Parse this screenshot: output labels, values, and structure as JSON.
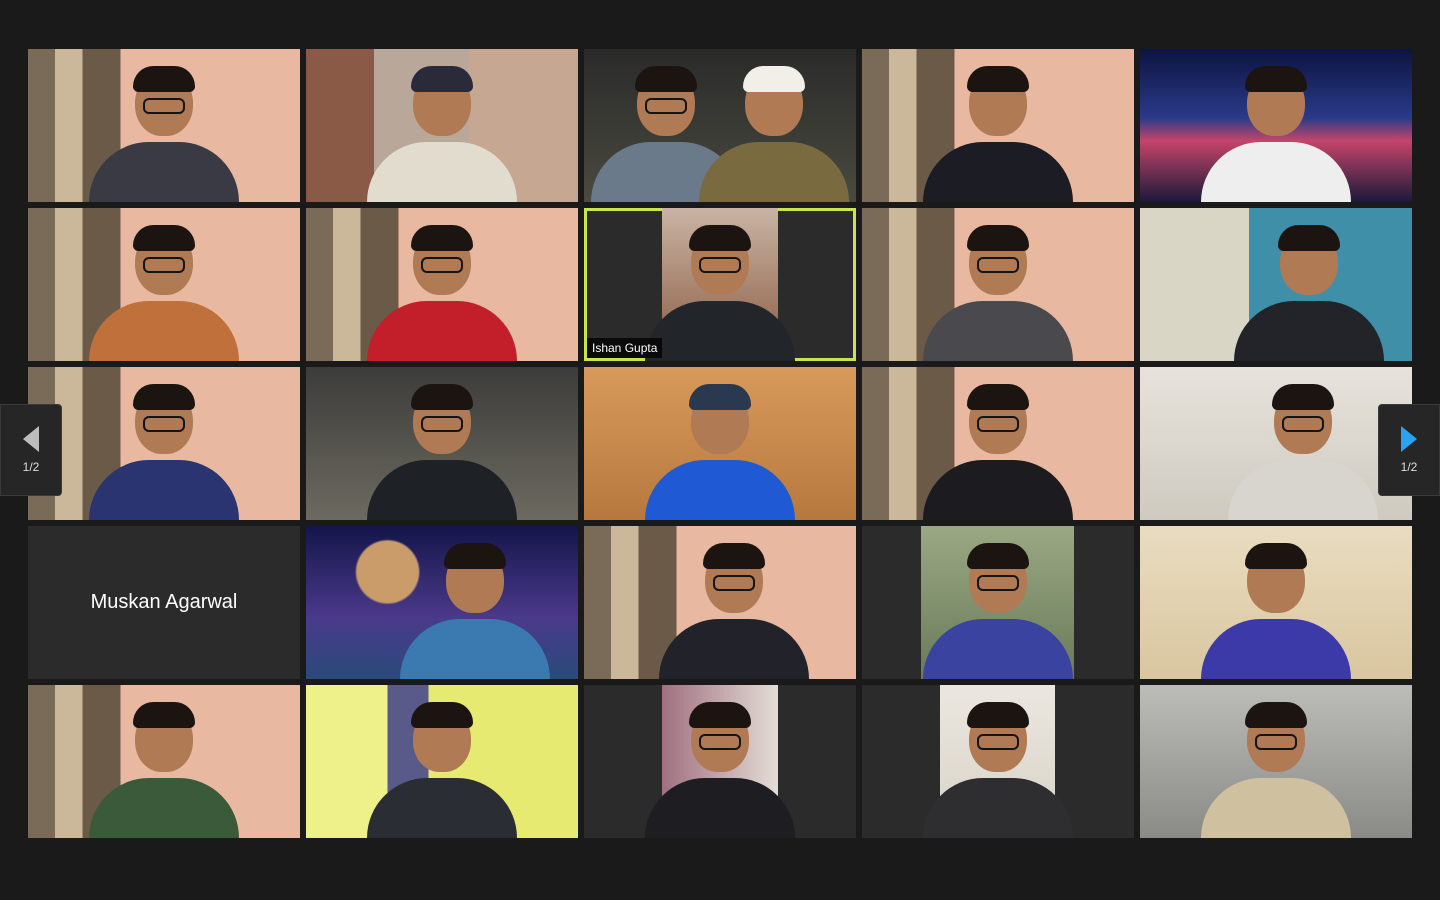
{
  "navigation": {
    "prev_page": "1/2",
    "next_page": "1/2",
    "next_arrow_color": "#2aa3f0"
  },
  "active_speaker": "Ishan Gupta",
  "participants": [
    {
      "name": "",
      "bg": "room"
    },
    {
      "name": "",
      "bg": "room2"
    },
    {
      "name": "",
      "bg": "dark"
    },
    {
      "name": "",
      "bg": "room"
    },
    {
      "name": "",
      "bg": "space"
    },
    {
      "name": "",
      "bg": "room"
    },
    {
      "name": "",
      "bg": "room"
    },
    {
      "name": "Ishan Gupta",
      "bg": "wall",
      "active": true
    },
    {
      "name": "",
      "bg": "room"
    },
    {
      "name": "",
      "bg": "green"
    },
    {
      "name": "",
      "bg": "room"
    },
    {
      "name": "",
      "bg": "wall"
    },
    {
      "name": "",
      "bg": "orange"
    },
    {
      "name": "",
      "bg": "room"
    },
    {
      "name": "",
      "bg": "white"
    },
    {
      "name": "Muskan Agarwal",
      "video_off": true
    },
    {
      "name": "",
      "bg": "doge"
    },
    {
      "name": "",
      "bg": "room"
    },
    {
      "name": "",
      "bg": "greenwall"
    },
    {
      "name": "",
      "bg": "cream"
    },
    {
      "name": "",
      "bg": "room"
    },
    {
      "name": "",
      "bg": "yellow"
    },
    {
      "name": "",
      "bg": "purple"
    },
    {
      "name": "",
      "bg": "pale"
    },
    {
      "name": "",
      "bg": "grey"
    }
  ],
  "labels": {
    "ishan": "Ishan Gupta",
    "muskan": "Muskan Agarwal"
  },
  "colors": {
    "active_border": "#c8e64a",
    "background": "#1a1a1a",
    "tile_off": "#2b2b2b"
  }
}
